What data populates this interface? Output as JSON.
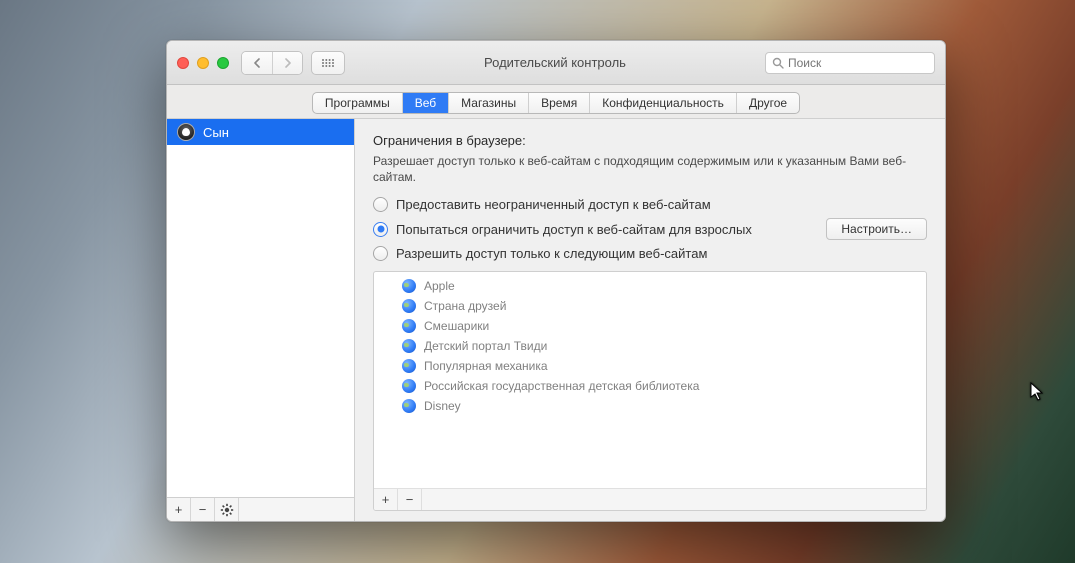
{
  "window": {
    "title": "Родительский контроль",
    "search_placeholder": "Поиск"
  },
  "tabs": [
    {
      "label": "Программы",
      "active": false
    },
    {
      "label": "Веб",
      "active": true
    },
    {
      "label": "Магазины",
      "active": false
    },
    {
      "label": "Время",
      "active": false
    },
    {
      "label": "Конфиденциальность",
      "active": false
    },
    {
      "label": "Другое",
      "active": false
    }
  ],
  "sidebar": {
    "users": [
      {
        "name": "Сын",
        "selected": true
      }
    ],
    "buttons": {
      "add": "+",
      "remove": "−",
      "gear": "✲"
    }
  },
  "content": {
    "section_title": "Ограничения в браузере:",
    "description": "Разрешает доступ только к веб-сайтам с подходящим содержимым или к указанным Вами веб-сайтам.",
    "radio_options": [
      {
        "label": "Предоставить неограниченный доступ к веб-сайтам",
        "checked": false
      },
      {
        "label": "Попытаться ограничить доступ к веб-сайтам для взрослых",
        "checked": true,
        "configure": true
      },
      {
        "label": "Разрешить доступ только к следующим веб-сайтам",
        "checked": false
      }
    ],
    "configure_button": "Настроить…",
    "sites": [
      "Apple",
      "Страна друзей",
      "Смешарики",
      "Детский портал Твиди",
      "Популярная механика",
      "Российская государственная детская библиотека",
      "Disney"
    ],
    "site_buttons": {
      "add": "+",
      "remove": "−"
    }
  }
}
